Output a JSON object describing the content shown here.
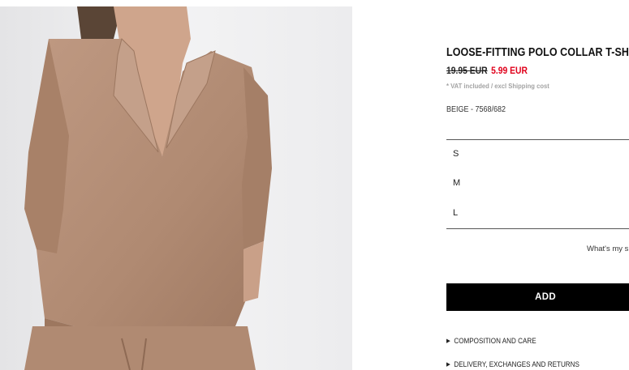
{
  "product": {
    "title": "LOOSE-FITTING POLO COLLAR T-SHIRT",
    "old_price": "19.95 EUR",
    "new_price": "5.99 EUR",
    "vat_note": "* VAT included / excl Shipping cost",
    "color_ref": "BEIGE - 7568/682",
    "sizes": [
      "S",
      "M",
      "L"
    ],
    "size_guide": "What's my size?",
    "add_label": "ADD",
    "sections": [
      {
        "arrow_icon": "triangle-right-icon",
        "label": "COMPOSITION AND CARE"
      },
      {
        "arrow_icon": "triangle-right-icon",
        "label": "DELIVERY, EXCHANGES AND RETURNS"
      }
    ]
  },
  "colors": {
    "sale_price": "#e0001b",
    "button_bg": "#000000",
    "garment": "#b38d75",
    "photo_bg": "#eeeef0"
  }
}
